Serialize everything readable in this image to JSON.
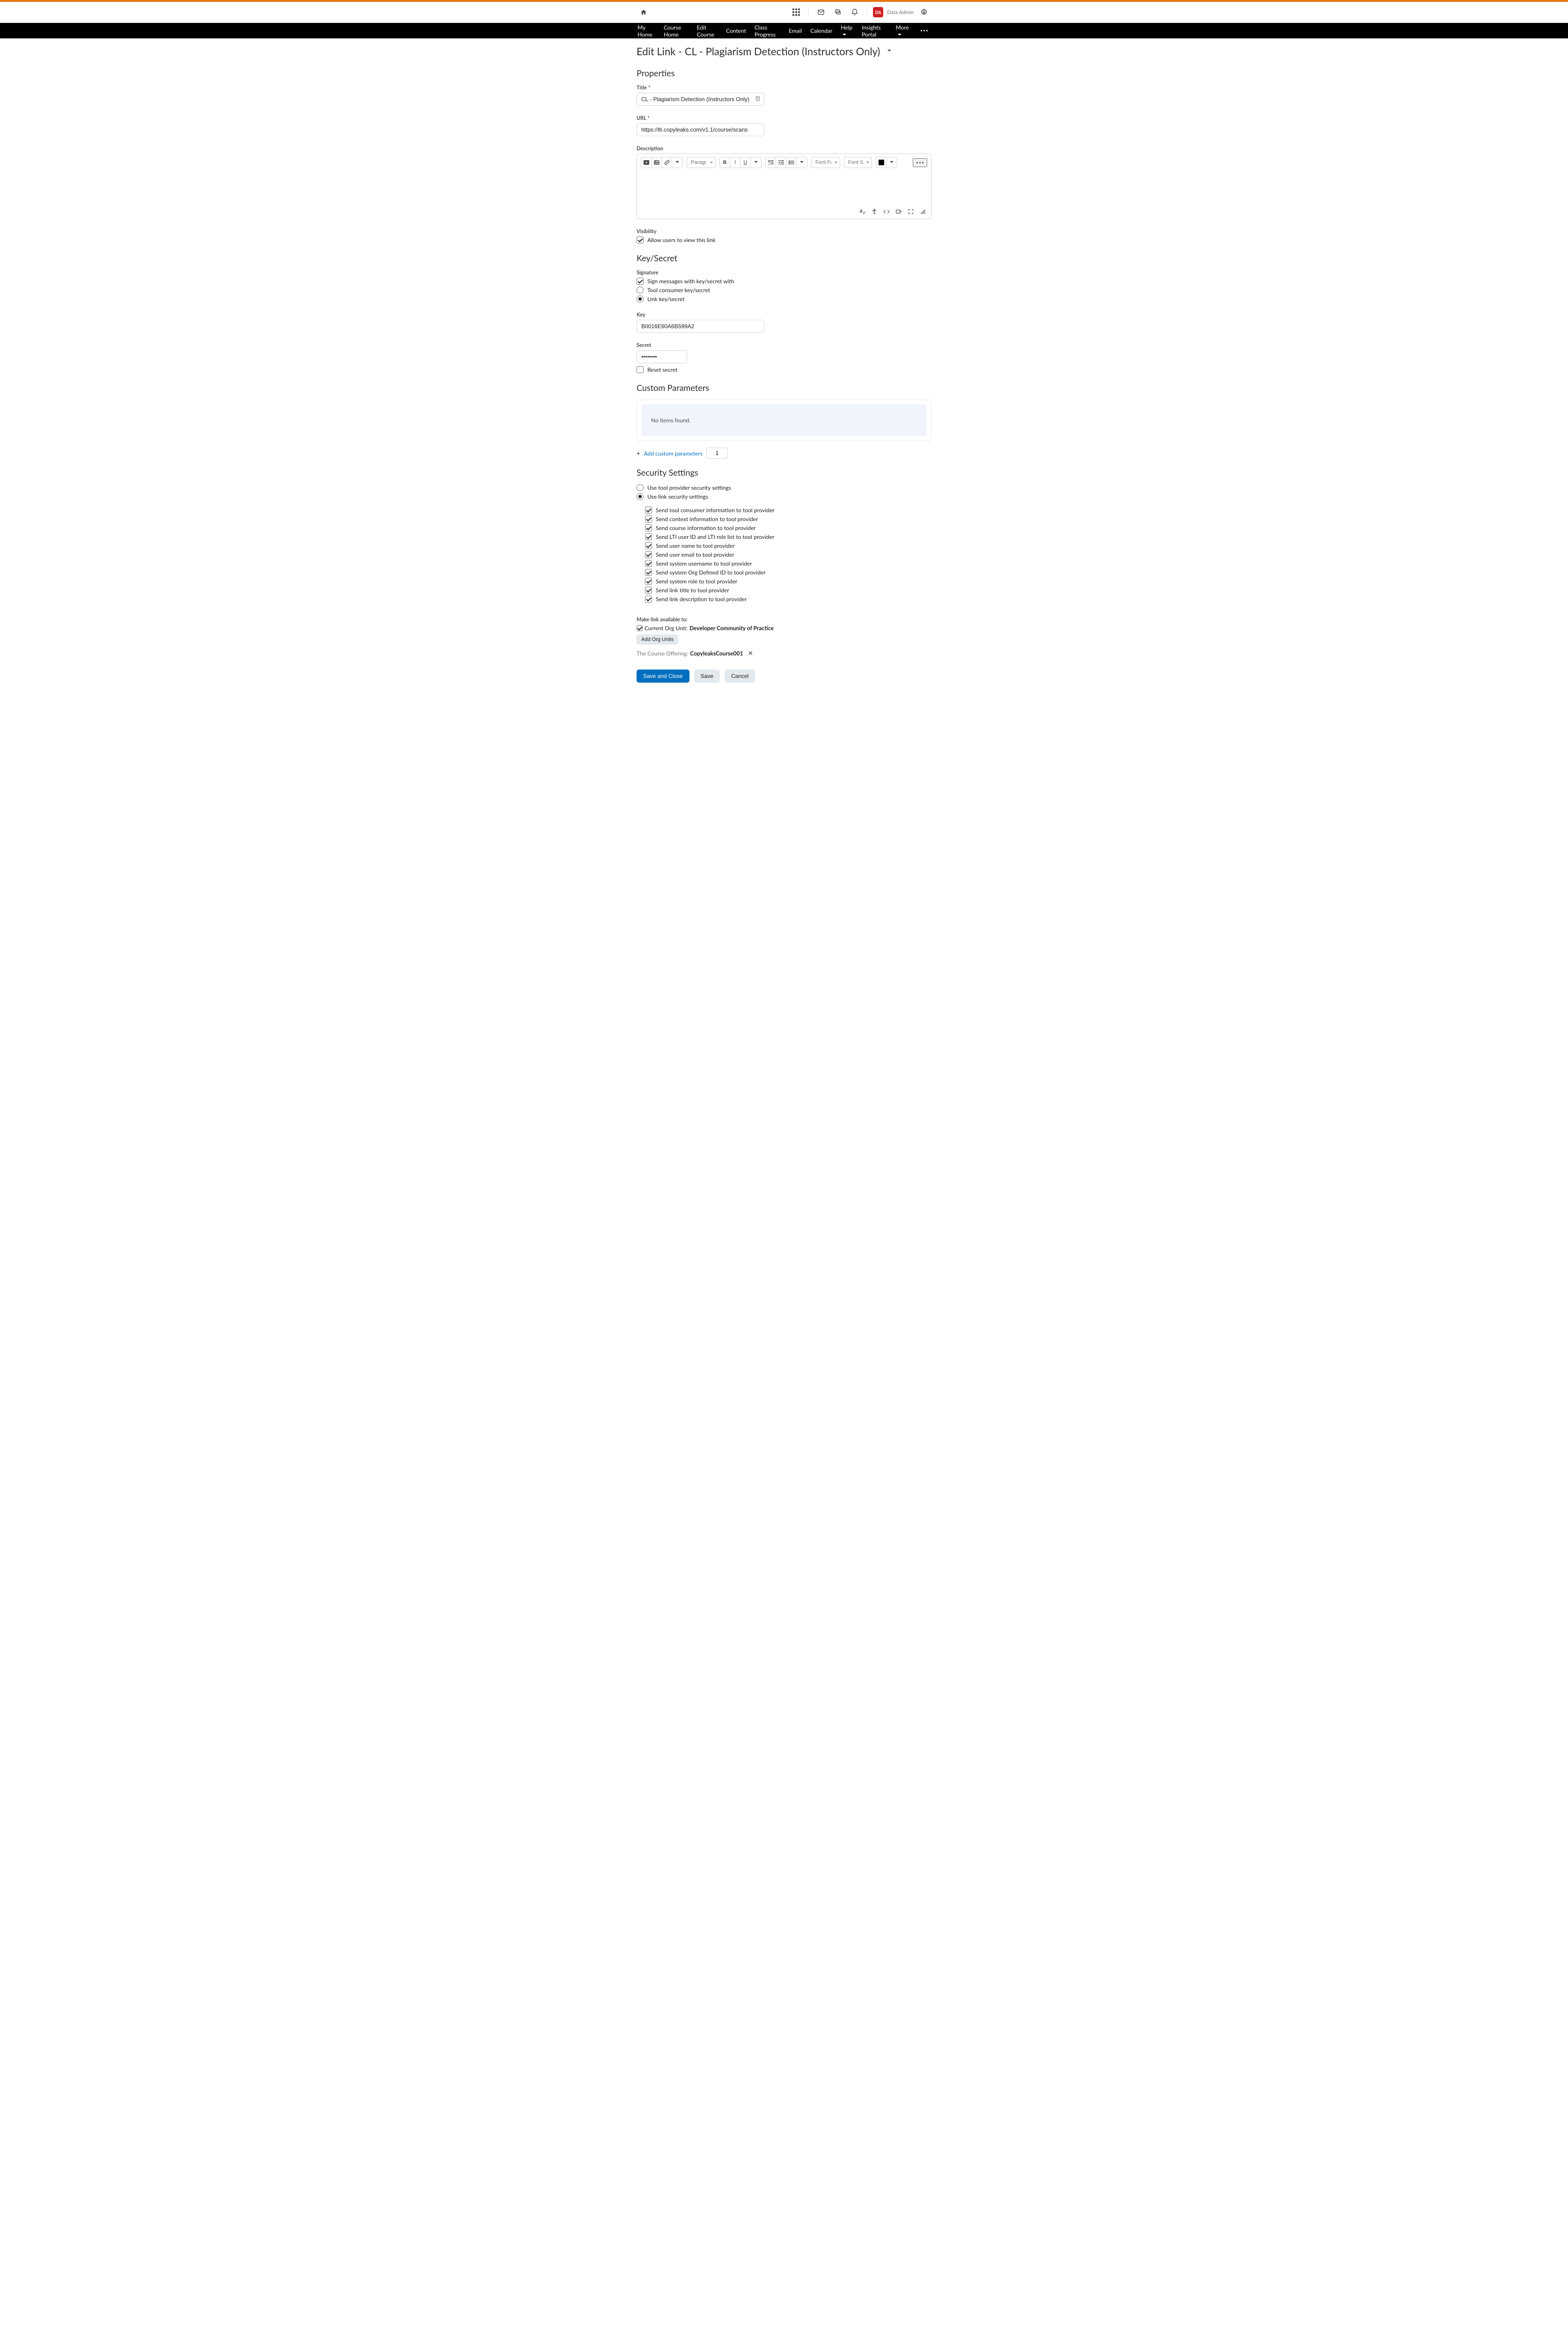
{
  "minibar": {
    "avatar_initials": "DA",
    "user_name": "Data Admin"
  },
  "nav": {
    "items": [
      "My Home",
      "Course Home",
      "Edit Course",
      "Content",
      "Class Progress",
      "Email",
      "Calendar",
      "Help",
      "Insights Portal",
      "More"
    ],
    "help_has_dd": true,
    "more_has_dd": true
  },
  "page_title": "Edit Link - CL - Plagiarism Detection (Instructors Only)",
  "sections": {
    "properties": "Properties",
    "key_secret": "Key/Secret",
    "custom_params": "Custom Parameters",
    "security": "Security Settings"
  },
  "labels": {
    "title": "Title",
    "url": "URL",
    "description": "Description",
    "visibility": "Visibility",
    "signature": "Signature",
    "key": "Key",
    "secret": "Secret",
    "make_available": "Make link available to:"
  },
  "fields": {
    "title_value": "CL - Plagiarism Detection (Instructors Only)",
    "url_value": "https://lti.copyleaks.com/v1.1/course/scans",
    "key_value": "B0016E60A6B599A2",
    "secret_value": "••••••••"
  },
  "rte": {
    "paragraph": "Paragraph",
    "font_family": "Font Famil",
    "font_size": "Font Size"
  },
  "visibility": {
    "allow_users": "Allow users to view this link"
  },
  "signature": {
    "sign_with": "Sign messages with key/secret with",
    "tool_consumer": "Tool consumer key/secret",
    "link_key": "Link key/secret",
    "reset_secret": "Reset secret"
  },
  "custom_params": {
    "empty": "No items found.",
    "add_label": "Add custom parameters",
    "count": "1"
  },
  "security": {
    "use_tool": "Use tool provider security settings",
    "use_link": "Use link security settings",
    "opts": [
      "Send tool consumer information to tool provider",
      "Send context information to tool provider",
      "Send course information to tool provider",
      "Send LTI user ID and LTI role list to tool provider",
      "Send user name to tool provider",
      "Send user email to tool provider",
      "Send system username to tool provider",
      "Send system Org Defined ID to tool provider",
      "Send system role to tool provider",
      "Send link title to tool provider",
      "Send link description to tool provider"
    ]
  },
  "availability": {
    "current_prefix": "Current Org Unit: ",
    "current_value": "Developer Community of Practice",
    "add_org_units": "Add Org Units",
    "course_prefix": "The Course Offering: ",
    "course_value": "CopyleaksCourse001"
  },
  "buttons": {
    "save_close": "Save and Close",
    "save": "Save",
    "cancel": "Cancel"
  }
}
